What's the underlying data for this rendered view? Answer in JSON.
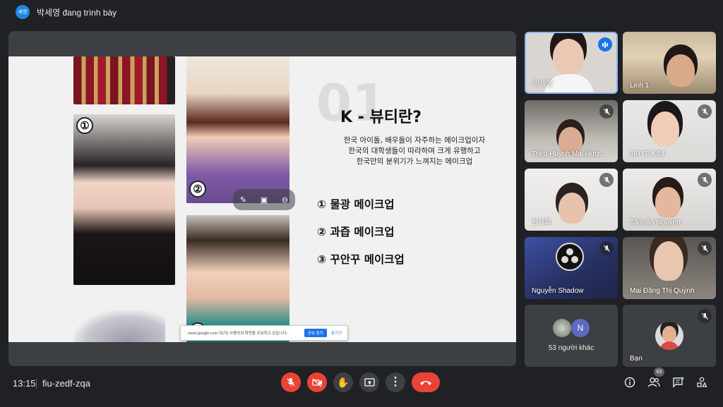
{
  "topbar": {
    "presenter_initials": "세영",
    "presenting_text": "박세영 đang trình bày"
  },
  "slide": {
    "big_number": "01",
    "title": "K - 뷰티란?",
    "description": [
      "한국 아이돌, 배우들이 자주하는 메이크업이자",
      "한국의 대학생들이 따라하며 크게 유행하고",
      "한국만의 분위기가 느껴지는 메이크업"
    ],
    "makeup_items": [
      "① 물광 메이크업",
      "② 과즙 메이크업",
      "③ 꾸안꾸 메이크업"
    ],
    "photo_numbers": [
      "①",
      "②",
      "③"
    ]
  },
  "share_notice": {
    "text": "meet.google.com 이(가) 사용자의 화면을 공유하고 있습니다.",
    "stop_label": "공유 중지",
    "hide_label": "숨기기"
  },
  "participants": [
    {
      "name": "박세영",
      "status": "speaking"
    },
    {
      "name": "Linh 1",
      "status": "none"
    },
    {
      "name": "Triệu Huỳnh Mai Hươ...",
      "status": "muted"
    },
    {
      "name": "JIHYE KIM",
      "status": "muted"
    },
    {
      "name": "임세희",
      "status": "muted"
    },
    {
      "name": "Tâm An Nguyễn",
      "status": "muted"
    },
    {
      "name": "Nguyễn Shadow",
      "status": "muted"
    },
    {
      "name": "Mai Đặng Thị Quỳnh",
      "status": "muted"
    }
  ],
  "others": {
    "avatar_letter": "N",
    "label": "53 người khác"
  },
  "self_tile": {
    "name": "Bạn"
  },
  "bottom": {
    "time": "13:15",
    "meeting_code": "fiu-zedf-zqa",
    "participants_count": "63"
  },
  "colors": {
    "accent": "#1a73e8",
    "danger": "#ea4335",
    "background": "#202124",
    "surface": "#3c4043"
  }
}
